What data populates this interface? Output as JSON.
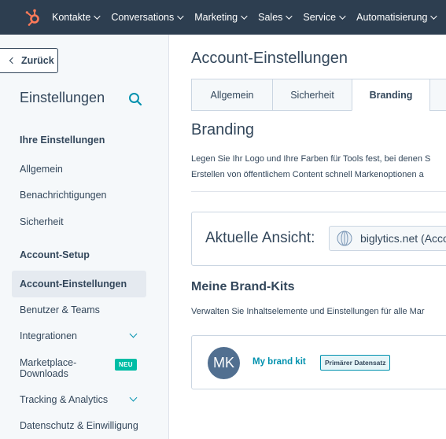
{
  "topnav": {
    "logo_icon": "hubspot-sprocket-icon",
    "items": [
      {
        "label": "Kontakte"
      },
      {
        "label": "Conversations"
      },
      {
        "label": "Marketing"
      },
      {
        "label": "Sales"
      },
      {
        "label": "Service"
      },
      {
        "label": "Automatisierung"
      }
    ]
  },
  "sidebar": {
    "back_label": "Zurück",
    "title": "Einstellungen",
    "search_icon": "search-icon",
    "sections": {
      "personal": "Ihre Einstellungen",
      "account": "Account-Setup"
    },
    "items": {
      "general": "Allgemein",
      "notifications": "Benachrichtigungen",
      "security": "Sicherheit",
      "account_settings": "Account-Einstellungen",
      "users_teams": "Benutzer & Teams",
      "integrations": "Integrationen",
      "marketplace": "Marketplace-Downloads",
      "tracking": "Tracking & Analytics",
      "privacy": "Datenschutz & Einwilligung"
    },
    "new_badge": "NEU"
  },
  "main": {
    "title": "Account-Einstellungen",
    "tabs": [
      {
        "label": "Allgemein"
      },
      {
        "label": "Sicherheit"
      },
      {
        "label": "Branding"
      }
    ],
    "branding_heading": "Branding",
    "branding_desc_line1": "Legen Sie Ihr Logo und Ihre Farben für Tools fest, bei denen S",
    "branding_desc_line2": "Erstellen von öffentlichem Content schnell Markenoptionen a",
    "current_view_label": "Aktuelle Ansicht:",
    "current_view_value": "biglytics.net (Acco",
    "brand_kits_heading": "Meine Brand-Kits",
    "brand_kits_desc": "Verwalten Sie Inhaltselemente und Einstellungen für alle Mar",
    "kit": {
      "avatar_text": "MK",
      "name": "My brand kit",
      "badge": "Primärer Datensatz"
    }
  },
  "colors": {
    "topnav_bg": "#2d3e50",
    "accent": "#0091ae",
    "logo": "#ff7a59",
    "new_badge": "#00bda5"
  }
}
